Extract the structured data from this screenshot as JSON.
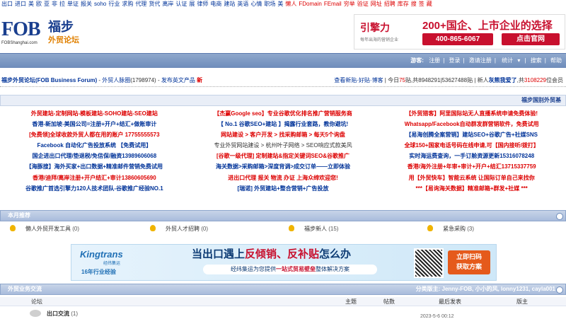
{
  "topnav": {
    "items": [
      "出口",
      "进口",
      "美",
      "欧",
      "亚",
      "非",
      "拉",
      "单证",
      "报关",
      "soho",
      "行业",
      "求购",
      "代理",
      "货代",
      "离岸",
      "认证",
      "展",
      "律师",
      "电商",
      "建站",
      "英语",
      "心情",
      "职场",
      "美"
    ],
    "red_items": [
      "懒人",
      "FDomain",
      "FEmail",
      "穷举",
      "验证",
      "网址",
      "招聘",
      "库存",
      "搜",
      "签",
      "藏"
    ]
  },
  "logo": {
    "fob": "FOB",
    "cn_title": "福步",
    "cn_sub": "外贸论坛",
    "domain_text": "FOBShanghai.com"
  },
  "ad_top": {
    "brand": "引擎力",
    "brand_sub": "每年出海的营销企业",
    "headline": "200+国企、上市企业的选择",
    "phone": "400-865-6067",
    "cta": "点击官网"
  },
  "navbar": {
    "guest_label": "游客:",
    "items": [
      "注册",
      "登录",
      "邀请注册",
      "统计",
      "搜索",
      "帮助"
    ],
    "separators": "|"
  },
  "breadcrumb": {
    "site": "福步外贸论坛(FOB Business Forum)",
    "sep": " - ",
    "circle_label": "外贸人脉圈",
    "circle_count": "(1798974)",
    "publish": "发布英文产品",
    "new_badge": "新"
  },
  "stats": {
    "links": "查看新贴·好贴·博客",
    "today_label": "今日",
    "today_num": "75",
    "today_unit": "贴,共",
    "threads": "8948291",
    "posts_sep": "|",
    "posts": "53627488",
    "posts_unit": "贴",
    "new_user_prefix": "新人",
    "new_user": "灰熊我爱了",
    "member_prefix": ",共",
    "members": "3108229",
    "member_unit": "位会员"
  },
  "strip": {
    "title": "福步国别外贸基"
  },
  "ad_grid": [
    [
      {
        "text": "外贸建站-定制网站-模板建站-SOHO建站-SEO建站",
        "color": "red"
      },
      {
        "text": "【杰赢Google seo】专业谷歌优化排名推广营销服务商",
        "color": "red"
      },
      {
        "text": "【外贸猎客】阿里国际站无人直播系统申请免费体验!",
        "color": "red"
      }
    ],
    [
      {
        "text": "香港-新加坡-美国公司=注册+开户+结汇+做账审计",
        "color": "blue"
      },
      {
        "text": "【 No.1 谷歌SEO+建站 】揭露行业套路，教你避坑!",
        "color": "blue"
      },
      {
        "text": "Whatsapp/Facebook自动群发群营销软件，免费试用",
        "color": "red"
      }
    ],
    [
      {
        "text": "[免费领]全球收款外贸人都在用的账户 17755555573",
        "color": "red"
      },
      {
        "text": "网站建设 > 客户开发 > 找采购邮箱 > 每天5个询盘",
        "color": "red"
      },
      {
        "text": "【易海创腾全案营销】建站SEO+谷歌广告+社媒SNS",
        "color": "blue"
      }
    ],
    [
      {
        "text": "Facebook 自动化广告投放系统 【免费试用】",
        "color": "blue"
      },
      {
        "text": "专业外贸网站建设 > 杭州叶子网络 > SEO响应式款美风",
        "color": "dark"
      },
      {
        "text": "全球150+国家电话号码在线申请,可【国内接听/拨打】",
        "color": "red"
      }
    ],
    [
      {
        "text": "国企进出口代理/垫退税/免信保/融资13989606068",
        "color": "blue"
      },
      {
        "text": "[谷歌一级代理] 定制建站&指定关键词SEO&谷歌推广",
        "color": "red"
      },
      {
        "text": "实时海运费查询，一手订舱资源更新15316078248",
        "color": "blue"
      }
    ],
    [
      {
        "text": "【海豚搜】海外买家+出口数据+精准邮件营销免费试用",
        "color": "blue"
      },
      {
        "text": "海关数据>采购邮箱>深度背调>成交订单——立即体验",
        "color": "blue"
      },
      {
        "text": "香港/海外注册+年审+审计+开户+结汇13715337759",
        "color": "red"
      }
    ],
    [
      {
        "text": "香港/迪拜/离岸注册+开户结汇+审计13860605690",
        "color": "red"
      },
      {
        "text": "进出口代理 报关 物流 办证 上海众缔欢迎您!",
        "color": "red"
      },
      {
        "text": "用【外贸快车】智能云系统 让国际订单自己来找你",
        "color": "red"
      }
    ],
    [
      {
        "text": "谷歌推广首选引擎力120人技术团队-谷歌推广经验NO.1",
        "color": "blue"
      },
      {
        "text": "[瑞诺] 外贸建站+整合营销+广告投放",
        "color": "blue"
      },
      {
        "text": "***【易询海关数据】精准邮箱+群发+社媒 ***",
        "color": "red"
      }
    ]
  ],
  "recommend": {
    "title": "本月推荐",
    "items": [
      {
        "name": "懒人外贸开发工具",
        "count": "(0)"
      },
      {
        "name": "外贸人才招聘",
        "count": "(0)"
      },
      {
        "name": "福步新人",
        "count": "(15)"
      },
      {
        "name": "紧急采购",
        "count": "(3)"
      }
    ]
  },
  "banner": {
    "brand": "Kingtrans",
    "brand_cn": "经纬集运",
    "years": "16年行业经验",
    "headline_pre": "当出口遇上",
    "headline_hl": "反倾销、反补贴",
    "headline_post": "怎么办",
    "sub_pre": "经纬集运为您提供",
    "sub_hl": "一站式贸易壁垒",
    "sub_post": "整体解决方案",
    "scan_1": "立即扫码",
    "scan_2": "获取方案"
  },
  "section2": {
    "title": "外贸业务交流",
    "moderators": "分类版主: Jenny-FOB, 小小的风, lonny1231, cayla001"
  },
  "thread_head": {
    "forum": "论坛",
    "topics": "主题",
    "posts": "帖数",
    "last": "最后发表",
    "mod": "版主"
  },
  "thread_rows": [
    {
      "name": "出口交流",
      "count": "(1)",
      "date": "2023-5-6 00:12"
    }
  ]
}
